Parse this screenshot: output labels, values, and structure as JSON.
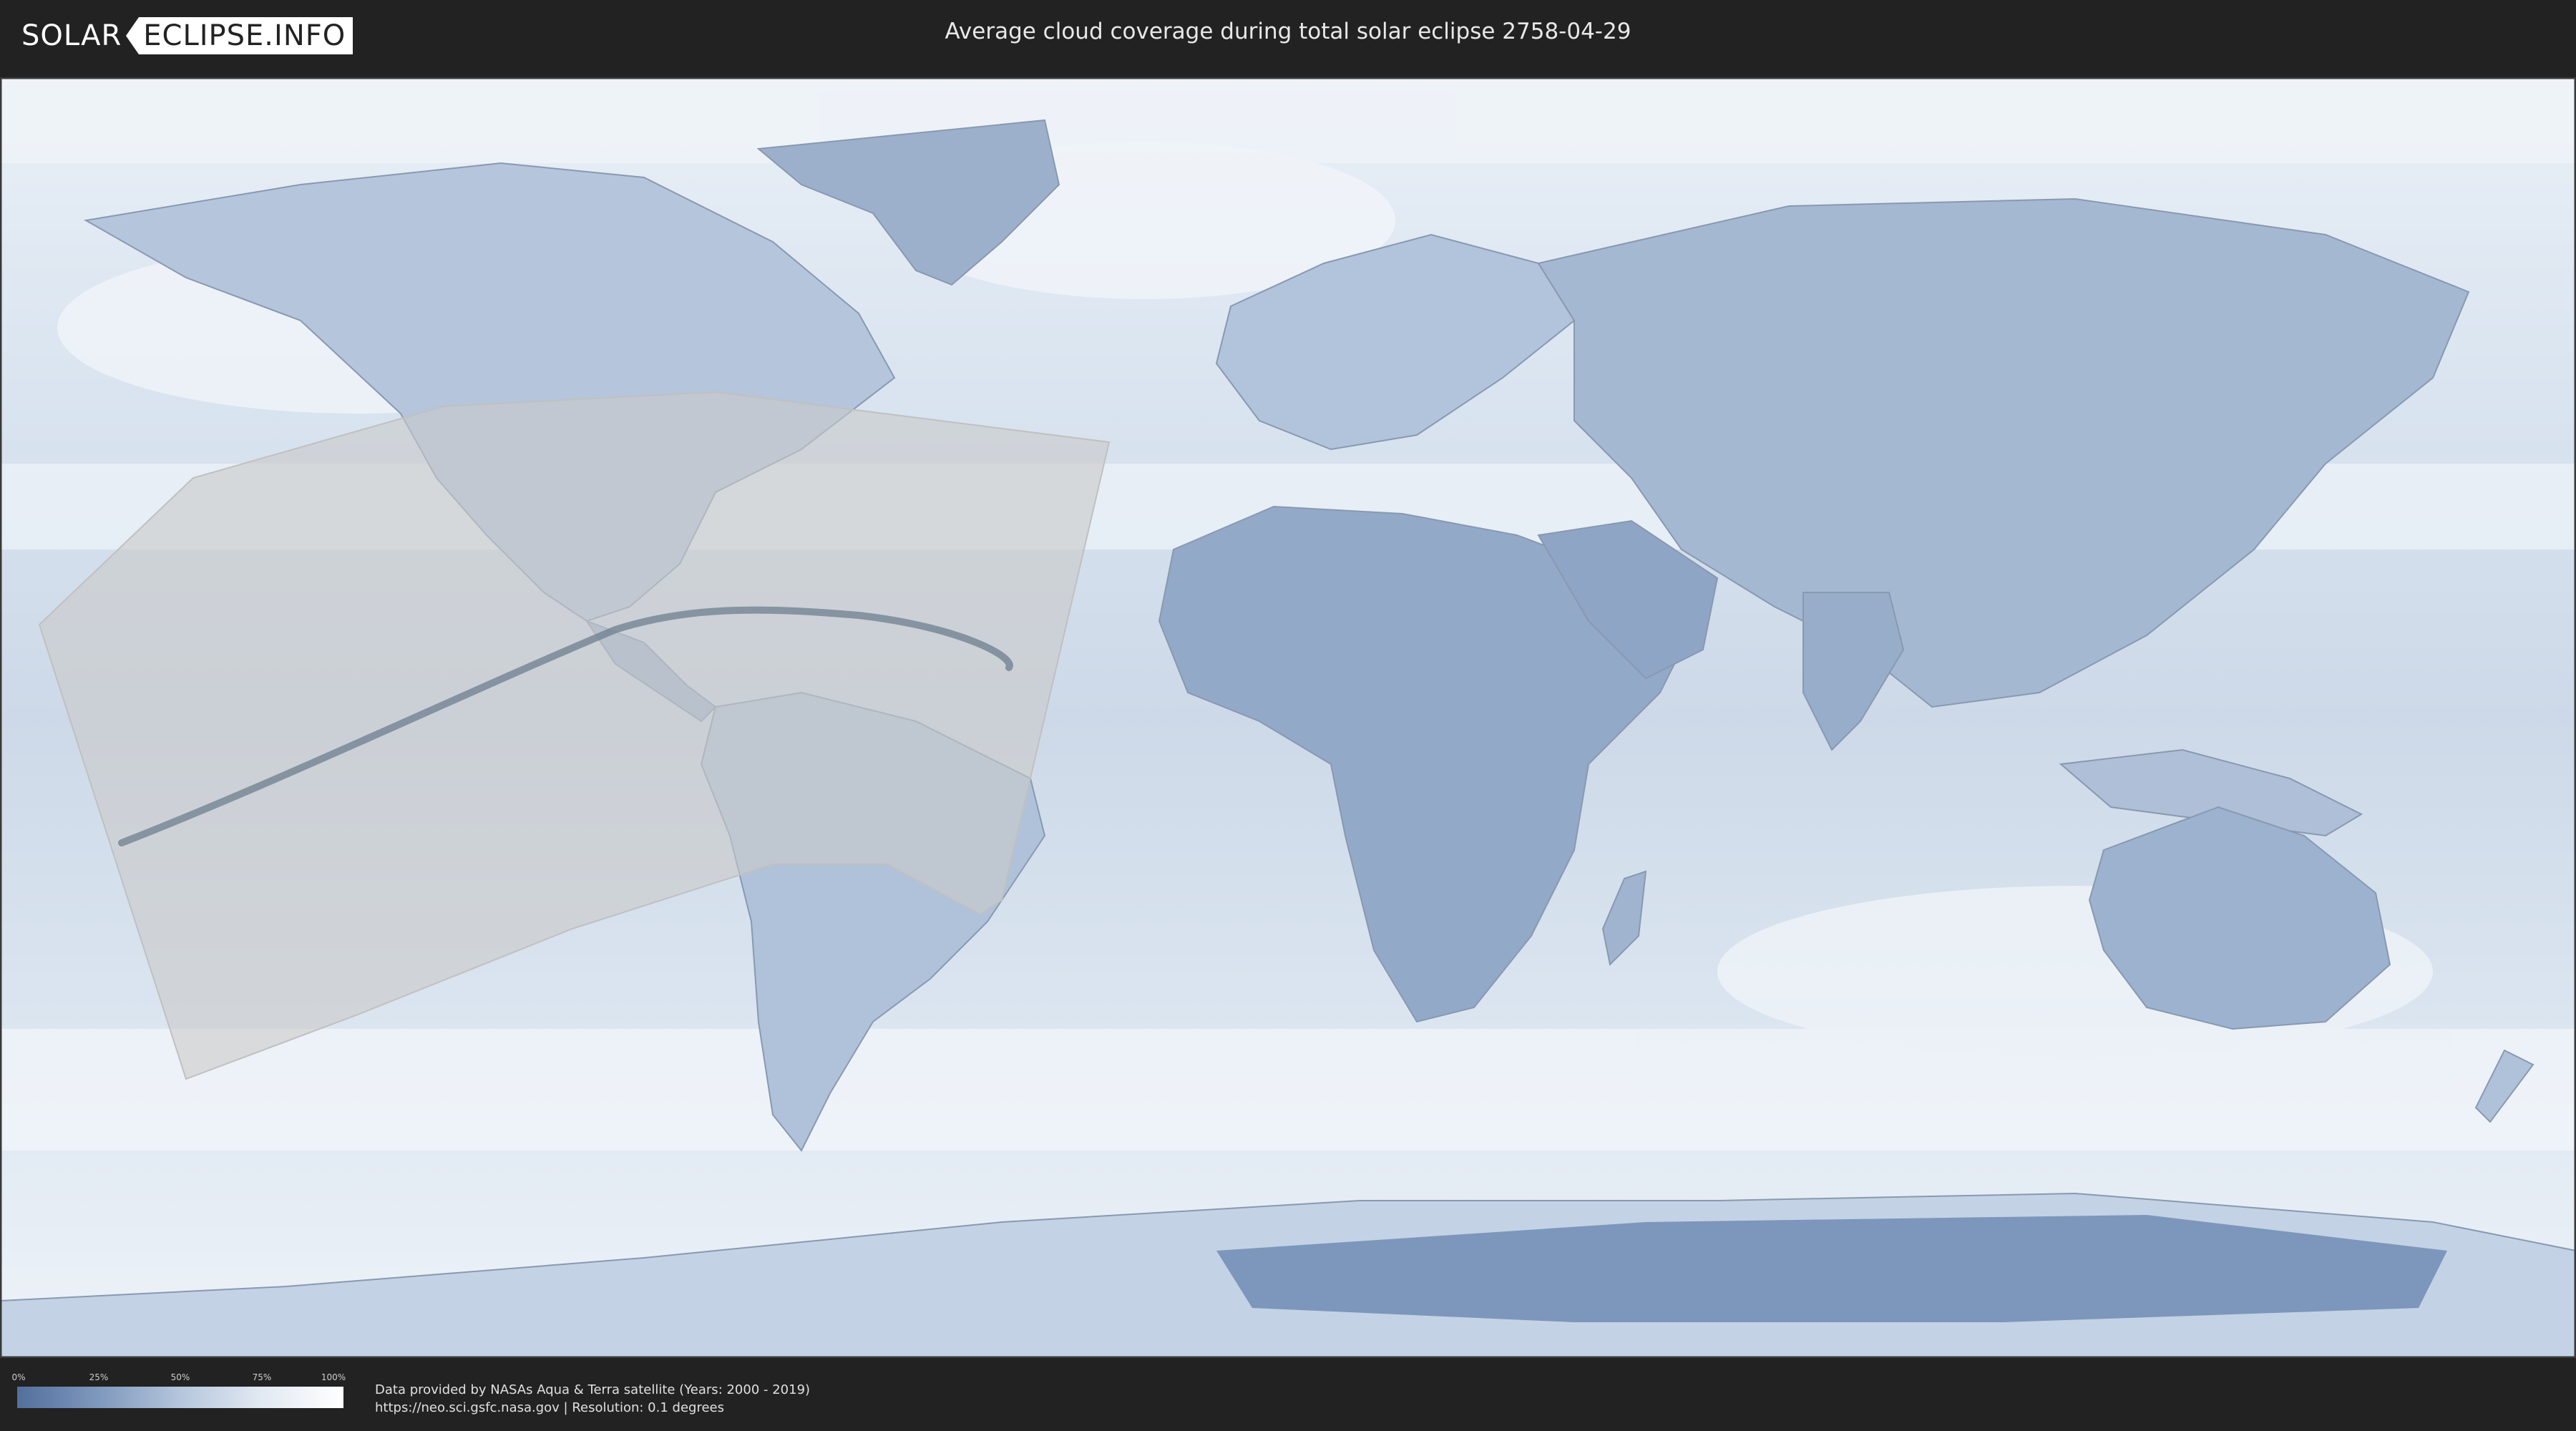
{
  "header": {
    "logo_left": "SOLAR",
    "logo_right": "ECLIPSE.INFO",
    "title": "Average cloud coverage during total solar eclipse 2758-04-29"
  },
  "map": {
    "ocean_color": "#c7d7e8",
    "land_color": "#a7bad3",
    "cloud_color": "#f3f6fa",
    "eclipse_zone_color": "#c9c9c9",
    "path_line_color": "#6d7d8f"
  },
  "legend": {
    "ticks": [
      "0%",
      "25%",
      "50%",
      "75%",
      "100%"
    ],
    "color_low": "#52709c",
    "color_high": "#ffffff"
  },
  "footer": {
    "line1": "Data provided by NASAs Aqua & Terra satellite (Years: 2000 - 2019)",
    "line2": "https://neo.sci.gsfc.nasa.gov | Resolution: 0.1 degrees"
  }
}
